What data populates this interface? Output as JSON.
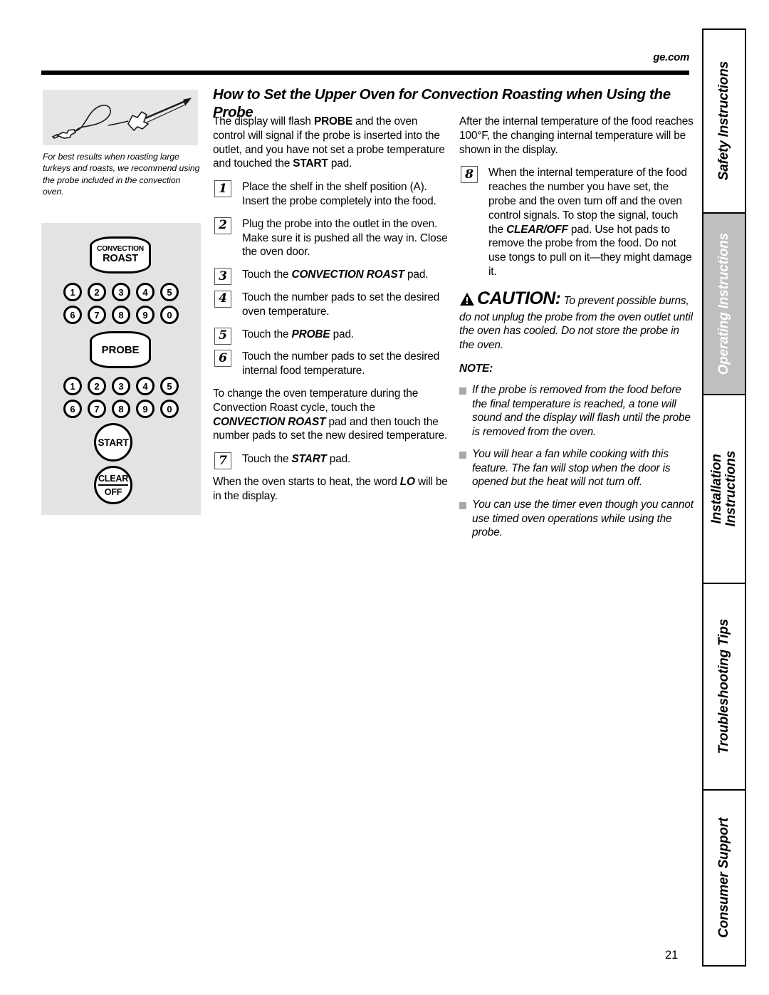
{
  "header": {
    "site_url": "ge.com"
  },
  "page_title": "How to Set the Upper Oven for Convection Roasting when Using the Probe",
  "page_number": "21",
  "figure": {
    "icon": "temperature-probe-illustration",
    "caption": "For best results when roasting large turkeys and roasts, we recommend using the probe included in the convection oven."
  },
  "keypad": {
    "convection_roast_line1": "CONVECTION",
    "convection_roast_line2": "ROAST",
    "probe_label": "PROBE",
    "start_label": "START",
    "clear_label": "CLEAR",
    "off_label": "OFF",
    "number_row_1": [
      "1",
      "2",
      "3",
      "4",
      "5"
    ],
    "number_row_2": [
      "6",
      "7",
      "8",
      "9",
      "0"
    ],
    "number_row_3": [
      "1",
      "2",
      "3",
      "4",
      "5"
    ],
    "number_row_4": [
      "6",
      "7",
      "8",
      "9",
      "0"
    ]
  },
  "left_column": {
    "intro_p1": "The display will flash ",
    "intro_b1": "PROBE",
    "intro_p2": " and the oven control will signal if the probe is inserted into the outlet, and you have not set a probe temperature and touched the ",
    "intro_b2": "START",
    "intro_p3": " pad.",
    "steps": [
      {
        "num": "1",
        "text": "Place the shelf in the shelf position (A). Insert the probe completely into the food."
      },
      {
        "num": "2",
        "text": "Plug the probe into the outlet in the oven. Make sure it is pushed all the way in. Close the oven door."
      },
      {
        "num": "3",
        "pre": "Touch the ",
        "bold": "CONVECTION ROAST",
        "post": " pad."
      },
      {
        "num": "4",
        "text": "Touch the number pads to set the desired oven temperature."
      },
      {
        "num": "5",
        "pre": "Touch the ",
        "bold": "PROBE",
        "post": " pad."
      },
      {
        "num": "6",
        "text": "Touch the number pads to set the desired internal food temperature."
      }
    ],
    "change_temp_p1": "To change the oven temperature during the Convection Roast cycle, touch the ",
    "change_temp_b1": "CONVECTION ROAST",
    "change_temp_p2": " pad and then touch the number pads to set the new desired temperature.",
    "step7": {
      "num": "7",
      "pre": "Touch the ",
      "bold": "START",
      "post": " pad."
    },
    "closing_p1": "When the oven starts to heat, the word ",
    "closing_b1": "LO",
    "closing_p2": " will be in the display."
  },
  "right_column": {
    "intro": "After the internal temperature of the food reaches 100°F, the changing internal temperature will be shown in the display.",
    "step8": {
      "num": "8",
      "pre": "When the internal temperature of the food reaches the number you have set, the probe and the oven turn off and the oven control signals. To stop the signal, touch the ",
      "bold": "CLEAR/OFF",
      "post": " pad. Use hot pads to remove the probe from the food. Do not use tongs to pull on it—they might damage it."
    },
    "caution": {
      "icon": "warning-triangle-icon",
      "heading": "CAUTION:",
      "body": " To prevent possible burns, do not unplug the probe from the oven outlet until the oven has cooled. Do not store the probe in the oven."
    },
    "note_heading": "NOTE:",
    "notes": [
      "If the probe is removed from the food before the final temperature is reached, a tone will sound and the display will flash until the probe is removed from the oven.",
      "You will hear a fan while cooking with this feature. The fan will stop when the door is opened but the heat will not turn off.",
      "You can use the timer even though you cannot use timed oven operations while using the probe."
    ]
  },
  "tabs": [
    {
      "label": "Safety Instructions",
      "active": false
    },
    {
      "label": "Operating Instructions",
      "active": true
    },
    {
      "label": "Installation\nInstructions",
      "active": false
    },
    {
      "label": "Troubleshooting Tips",
      "active": false
    },
    {
      "label": "Consumer Support",
      "active": false
    }
  ],
  "colors": {
    "panel_gray": "#e3e3e3",
    "figure_gray": "#e6e6e6",
    "tab_active": "#bfbfbf",
    "bullet_gray": "#a8a8a8"
  }
}
